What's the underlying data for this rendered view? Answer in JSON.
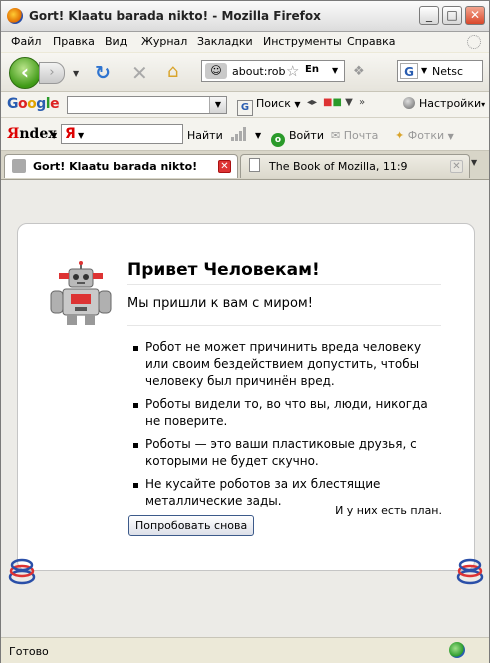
{
  "window": {
    "title": "Gort! Klaatu barada nikto! - Mozilla Firefox"
  },
  "menu": [
    "Файл",
    "Правка",
    "Вид",
    "Журнал",
    "Закладки",
    "Инструменты",
    "Справка"
  ],
  "nav": {
    "url": "about:rob",
    "lang": "En",
    "search_value": "Netsc"
  },
  "google_bar": {
    "search_label": "Гугл",
    "search_button": "Поиск",
    "settings": "Настройки"
  },
  "yandex_bar": {
    "logo": "Яndex",
    "find": "Найти",
    "login": "Войти",
    "mail": "Почта",
    "photos": "Фотки"
  },
  "tabs": [
    {
      "title": "Gort! Klaatu barada nikto!"
    },
    {
      "title": "The Book of Mozilla, 11:9"
    }
  ],
  "page": {
    "heading": "Привет Человекам!",
    "subheading": "Мы пришли к вам с миром!",
    "laws": [
      "Робот не может причинить вреда человеку или своим бездействием допустить, чтобы человеку был причинён вред.",
      "Роботы видели то, во что вы, люди, никогда не поверите.",
      "Роботы — это ваши пластиковые друзья, с которыми не будет скучно.",
      "Не кусайте роботов за их блестящие металлические зады."
    ],
    "plan": "И у них есть план.",
    "retry_button": "Попробовать снова"
  },
  "status": {
    "text": "Готово"
  }
}
